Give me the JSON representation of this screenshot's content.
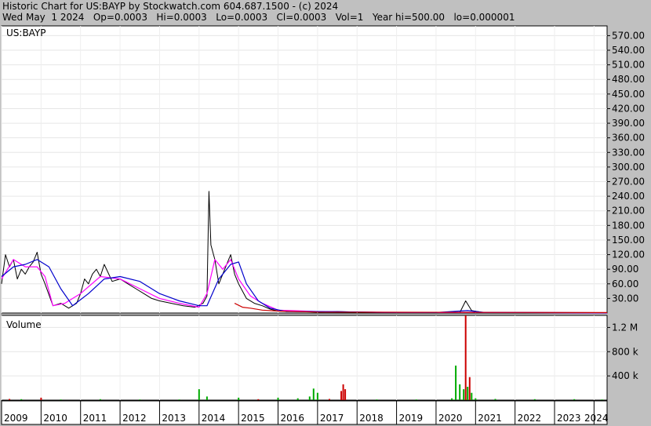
{
  "header": {
    "line1": "Historic Chart for US:BAYP by Stockwatch.com 604.687.1500 - (c) 2024",
    "line2": "Wed May  1 2024   Op=0.0003   Hi=0.0003   Lo=0.0003   Cl=0.0003   Vol=1   Year hi=500.00   lo=0.000001"
  },
  "chart_data": [
    {
      "type": "line",
      "title": "US:BAYP",
      "ylim": [
        0,
        590
      ],
      "y_ticks": [
        "570.00",
        "540.00",
        "510.00",
        "480.00",
        "450.00",
        "420.00",
        "390.00",
        "360.00",
        "330.00",
        "300.00",
        "270.00",
        "240.00",
        "210.00",
        "180.00",
        "150.00",
        "120.00",
        "90.00",
        "60.00",
        "30.00"
      ],
      "x_ticks": [
        "2009",
        "2010",
        "2011",
        "2012",
        "2013",
        "2014",
        "2015",
        "2016",
        "2017",
        "2018",
        "2019",
        "2020",
        "2021",
        "2022",
        "2023",
        "2024"
      ],
      "colors": {
        "price": "#000000",
        "ma_short": "#ff00ff",
        "ma_long": "#0000cc",
        "ma_fast": "#cc0000"
      },
      "series": [
        {
          "name": "",
          "x": [
            2009.0,
            2009.05,
            2009.1,
            2009.2,
            2009.3,
            2009.4,
            2009.5,
            2009.6,
            2009.7,
            2009.8,
            2009.9,
            2010.0,
            2010.1,
            2010.3,
            2010.5,
            2010.7,
            2010.9,
            2011.0,
            2011.1,
            2011.2,
            2011.3,
            2011.4,
            2011.5,
            2011.6,
            2011.8,
            2012.0,
            2012.2,
            2012.4,
            2012.6,
            2012.8,
            2013.0,
            2013.3,
            2013.6,
            2013.9,
            2014.1,
            2014.2,
            2014.25,
            2014.3,
            2014.4,
            2014.5,
            2014.6,
            2014.7,
            2014.8,
            2014.9,
            2015.0,
            2015.1,
            2015.2,
            2015.4,
            2015.6,
            2015.8,
            2016.0,
            2016.5,
            2017.0,
            2017.5,
            2018.0,
            2019.0,
            2020.0,
            2020.6,
            2020.75,
            2020.9,
            2021.2,
            2022.0,
            2023.0,
            2024.0,
            2024.33
          ],
          "y": [
            60,
            90,
            120,
            95,
            110,
            70,
            90,
            80,
            95,
            105,
            125,
            80,
            60,
            15,
            20,
            10,
            20,
            40,
            70,
            60,
            80,
            90,
            75,
            100,
            65,
            70,
            60,
            50,
            40,
            30,
            25,
            20,
            15,
            12,
            20,
            35,
            250,
            140,
            110,
            60,
            80,
            100,
            120,
            80,
            60,
            45,
            30,
            20,
            15,
            8,
            4,
            3,
            2,
            3,
            2,
            1.5,
            1.0,
            0.8,
            25,
            5,
            1.0,
            0.5,
            0.3,
            0.2,
            0.0003
          ]
        },
        {
          "name": "",
          "x": [
            2009.0,
            2009.3,
            2009.6,
            2009.9,
            2010.1,
            2010.3,
            2010.6,
            2011.0,
            2011.5,
            2012.0,
            2012.5,
            2013.0,
            2013.5,
            2014.0,
            2014.2,
            2014.4,
            2014.6,
            2014.8,
            2015.0,
            2015.3,
            2015.6,
            2016.0,
            2017.0,
            2018.0,
            2020.0,
            2021.0,
            2024.33
          ],
          "y": [
            70,
            110,
            95,
            95,
            75,
            15,
            20,
            40,
            75,
            70,
            50,
            30,
            20,
            12,
            40,
            110,
            90,
            110,
            70,
            35,
            20,
            6,
            3,
            2,
            1,
            1.5,
            0.3
          ]
        },
        {
          "name": "",
          "x": [
            2009.0,
            2009.3,
            2009.6,
            2009.9,
            2010.2,
            2010.5,
            2010.8,
            2011.2,
            2011.6,
            2012.0,
            2012.5,
            2013.0,
            2013.5,
            2014.0,
            2014.2,
            2014.5,
            2014.8,
            2015.0,
            2015.2,
            2015.5,
            2015.8,
            2016.2,
            2016.8,
            2017.5,
            2018.5,
            2020.0,
            2020.8,
            2021.2,
            2024.33
          ],
          "y": [
            75,
            95,
            100,
            110,
            95,
            50,
            15,
            40,
            70,
            75,
            65,
            40,
            25,
            15,
            15,
            70,
            100,
            105,
            60,
            25,
            10,
            3,
            3,
            2.5,
            1.5,
            1,
            5,
            1.5,
            0.5
          ]
        },
        {
          "name": "",
          "x": [
            2014.9,
            2015.1,
            2015.3,
            2015.6,
            2016.0,
            2016.5,
            2017.0,
            2024.33
          ],
          "y": [
            20,
            12,
            10,
            6,
            4,
            3,
            2,
            1
          ]
        }
      ]
    },
    {
      "type": "bar",
      "title": "Volume",
      "ylim": [
        0,
        1400000
      ],
      "y_ticks": [
        "1.2 M",
        "800 k",
        "400 k"
      ],
      "colors": {
        "up": "#00aa00",
        "down": "#cc0000"
      },
      "x": [
        2009.2,
        2009.5,
        2010.0,
        2010.5,
        2011.5,
        2012.5,
        2013.5,
        2014.0,
        2014.2,
        2015.0,
        2015.5,
        2016.0,
        2016.5,
        2016.8,
        2016.9,
        2017.0,
        2017.3,
        2017.6,
        2017.65,
        2017.7,
        2018.5,
        2019.5,
        2020.4,
        2020.5,
        2020.6,
        2020.7,
        2020.75,
        2020.8,
        2020.85,
        2020.9,
        2021.0,
        2021.5,
        2022.5,
        2023.5,
        2024.2
      ],
      "values": [
        20000,
        15000,
        40000,
        10000,
        15000,
        10000,
        10000,
        180000,
        60000,
        40000,
        15000,
        40000,
        30000,
        60000,
        190000,
        120000,
        20000,
        150000,
        260000,
        180000,
        10000,
        10000,
        30000,
        570000,
        260000,
        180000,
        1400000,
        220000,
        380000,
        120000,
        30000,
        20000,
        15000,
        15000,
        10000
      ],
      "direction": [
        "down",
        "up",
        "down",
        "up",
        "up",
        "up",
        "up",
        "up",
        "up",
        "up",
        "down",
        "up",
        "up",
        "up",
        "up",
        "up",
        "down",
        "down",
        "down",
        "down",
        "up",
        "up",
        "up",
        "up",
        "up",
        "up",
        "down",
        "up",
        "down",
        "up",
        "up",
        "up",
        "up",
        "up",
        "up"
      ]
    }
  ]
}
